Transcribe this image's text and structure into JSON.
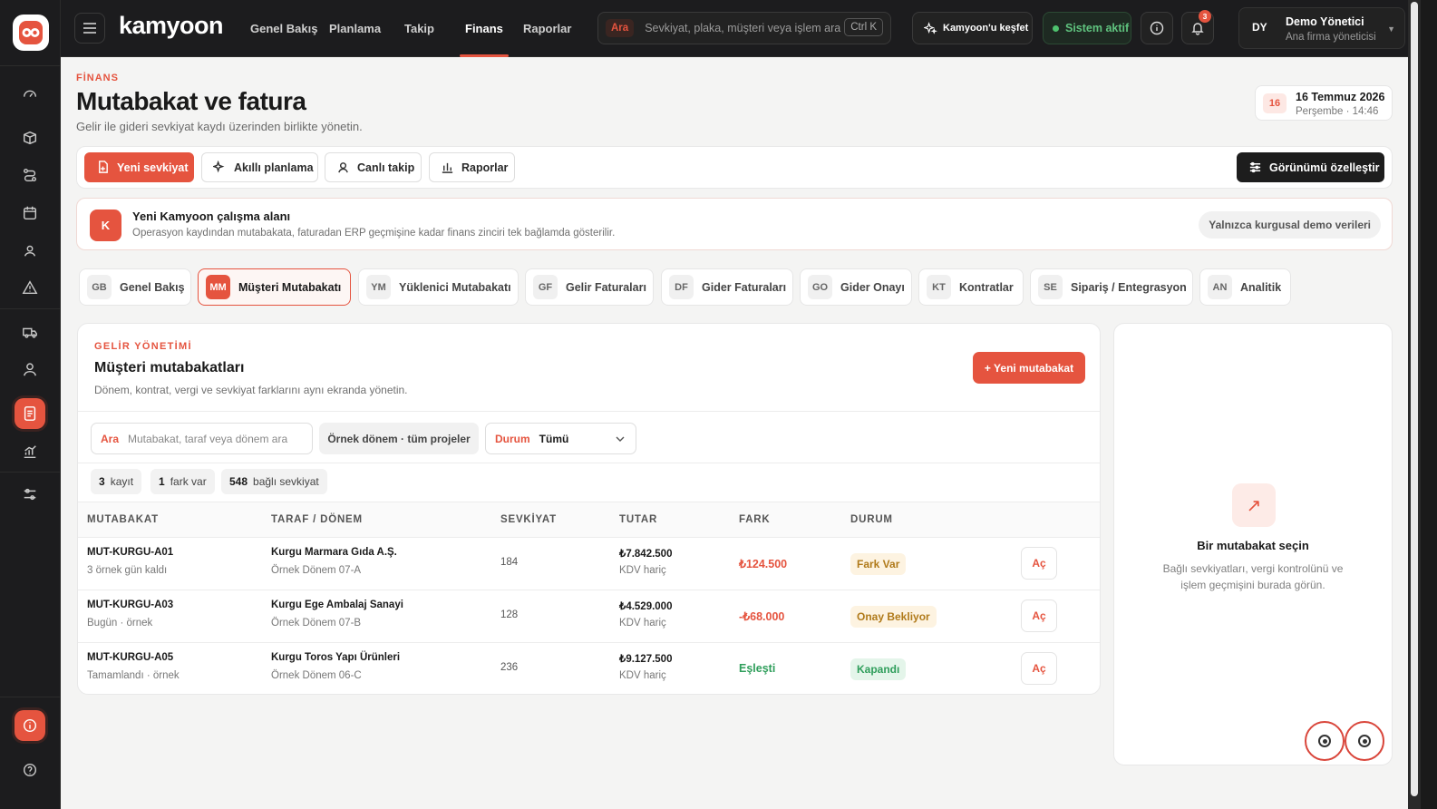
{
  "brand": "kamyoon",
  "nav": [
    "Genel Bakış",
    "Planlama",
    "Takip",
    "Finans",
    "Raporlar"
  ],
  "search": {
    "tag": "Ara",
    "placeholder": "Sevkiyat, plaka, müşteri veya işlem ara",
    "shortcut": "Ctrl K"
  },
  "explore": "Kamyoon'u keşfet",
  "status": "Sistem aktif",
  "notifications": "3",
  "user": {
    "initials": "DY",
    "name": "Demo Yönetici",
    "role": "Ana firma yöneticisi"
  },
  "page": {
    "crumb": "FİNANS",
    "title": "Mutabakat ve fatura",
    "subtitle": "Gelir ile gideri sevkiyat kaydı üzerinden birlikte yönetin."
  },
  "date": {
    "day": "16",
    "full": "16 Temmuz 2026",
    "detail": "Perşembe · 14:46"
  },
  "actions": {
    "new_shipment": "Yeni sevkiyat",
    "smart_plan": "Akıllı planlama",
    "live": "Canlı takip",
    "reports": "Raporlar",
    "customize": "Görünümü özelleştir"
  },
  "notice": {
    "badge": "K",
    "title": "Yeni Kamyoon çalışma alanı",
    "text": "Operasyon kaydından mutabakata, faturadan ERP geçmişine kadar finans zinciri tek bağlamda gösterilir.",
    "pill": "Yalnızca kurgusal demo verileri"
  },
  "tabs": [
    {
      "ab": "GB",
      "label": "Genel Bakış"
    },
    {
      "ab": "MM",
      "label": "Müşteri Mutabakatı"
    },
    {
      "ab": "YM",
      "label": "Yüklenici Mutabakatı"
    },
    {
      "ab": "GF",
      "label": "Gelir Faturaları"
    },
    {
      "ab": "DF",
      "label": "Gider Faturaları"
    },
    {
      "ab": "GO",
      "label": "Gider Onayı"
    },
    {
      "ab": "KT",
      "label": "Kontratlar"
    },
    {
      "ab": "SE",
      "label": "Sipariş / Entegrasyon"
    },
    {
      "ab": "AN",
      "label": "Analitik"
    }
  ],
  "panel": {
    "section": "GELİR YÖNETİMİ",
    "title": "Müşteri mutabakatları",
    "desc": "Dönem, kontrat, vergi ve sevkiyat farklarını aynı ekranda yönetin.",
    "new_btn": "+ Yeni mutabakat"
  },
  "filters": {
    "search_label": "Ara",
    "search_placeholder": "Mutabakat, taraf veya dönem ara",
    "period": "Örnek dönem · tüm projeler",
    "status_label": "Durum",
    "status_value": "Tümü"
  },
  "chips": [
    {
      "n": "3",
      "t": "kayıt"
    },
    {
      "n": "1",
      "t": "fark var"
    },
    {
      "n": "548",
      "t": "bağlı sevkiyat"
    }
  ],
  "columns": [
    "MUTABAKAT",
    "TARAF / DÖNEM",
    "SEVKİYAT",
    "TUTAR",
    "FARK",
    "DURUM"
  ],
  "rows": [
    {
      "id": "MUT-KURGU-A01",
      "due": "3 örnek gün kaldı",
      "party": "Kurgu Marmara Gıda A.Ş.",
      "period": "Örnek Dönem 07-A",
      "ship": "184",
      "amount": "₺7.842.500",
      "tax": "KDV hariç",
      "diff": "₺124.500",
      "status": "Fark Var",
      "action": "Aç"
    },
    {
      "id": "MUT-KURGU-A03",
      "due": "Bugün · örnek",
      "party": "Kurgu Ege Ambalaj Sanayi",
      "period": "Örnek Dönem 07-B",
      "ship": "128",
      "amount": "₺4.529.000",
      "tax": "KDV hariç",
      "diff": "-₺68.000",
      "status": "Onay Bekliyor",
      "action": "Aç"
    },
    {
      "id": "MUT-KURGU-A05",
      "due": "Tamamlandı · örnek",
      "party": "Kurgu Toros Yapı Ürünleri",
      "period": "Örnek Dönem 06-C",
      "ship": "236",
      "amount": "₺9.127.500",
      "tax": "KDV hariç",
      "diff": "Eşleşti",
      "status": "Kapandı",
      "action": "Aç"
    }
  ],
  "side": {
    "title": "Bir mutabakat seçin",
    "desc": "Bağlı sevkiyatları, vergi kontrolünü ve işlem geçmişini burada görün."
  },
  "colors": {
    "accent": "#e5543f",
    "dark": "#1c1c1e",
    "warn": "#b8860b",
    "ok": "#2f9e5b"
  }
}
